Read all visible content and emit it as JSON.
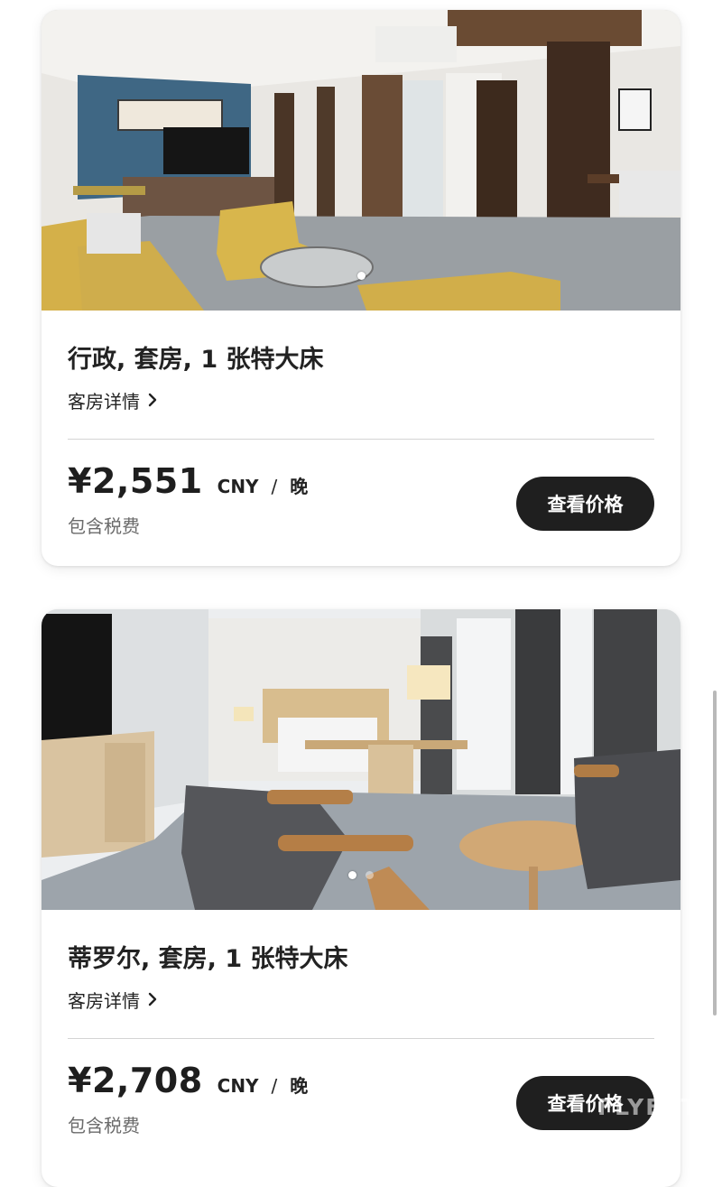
{
  "rooms": [
    {
      "title": "行政, 套房, 1 张特大床",
      "details_label": "客房详情",
      "price": "¥2,551",
      "currency": "CNY",
      "separator": "/",
      "per_unit": "晚",
      "tax_note": "包含税费",
      "button_label": "查看价格",
      "carousel": {
        "total": 1,
        "active": 1
      }
    },
    {
      "title": "蒂罗尔, 套房, 1 张特大床",
      "details_label": "客房详情",
      "price": "¥2,708",
      "currency": "CNY",
      "separator": "/",
      "per_unit": "晚",
      "tax_note": "包含税费",
      "button_label": "查看价格",
      "carousel": {
        "total": 2,
        "active": 1
      }
    }
  ],
  "watermark": "FLYERT",
  "colors": {
    "button_bg": "#1f1f1f",
    "button_text": "#ffffff",
    "tax_text": "#6b6b6b"
  }
}
